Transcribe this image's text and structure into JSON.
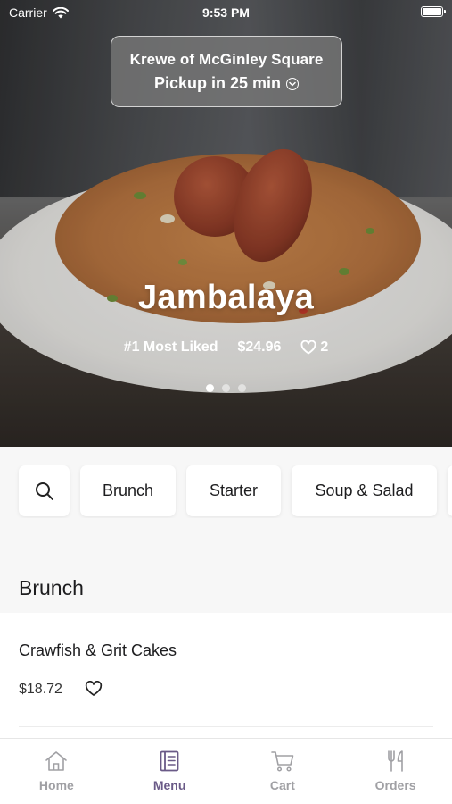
{
  "status_bar": {
    "carrier": "Carrier",
    "time": "9:53 PM"
  },
  "pickup": {
    "store": "Krewe of McGinley Square",
    "eta": "Pickup in 25 min"
  },
  "hero": {
    "title": "Jambalaya",
    "badge": "#1 Most Liked",
    "price": "$24.96",
    "likes": "2",
    "page_count": 3,
    "active_page": 0
  },
  "categories": {
    "search_icon": "search-icon",
    "items": [
      "Brunch",
      "Starter",
      "Soup & Salad"
    ]
  },
  "section_title": "Brunch",
  "menu_items": [
    {
      "name": "Crawfish & Grit Cakes",
      "price": "$18.72"
    }
  ],
  "tabs": [
    {
      "label": "Home",
      "icon": "home-icon",
      "active": false
    },
    {
      "label": "Menu",
      "icon": "menu-icon",
      "active": true
    },
    {
      "label": "Cart",
      "icon": "cart-icon",
      "active": false
    },
    {
      "label": "Orders",
      "icon": "utensils-icon",
      "active": false
    }
  ],
  "colors": {
    "accent": "#6a5a87",
    "inactive_tab": "#a0a0a4"
  }
}
